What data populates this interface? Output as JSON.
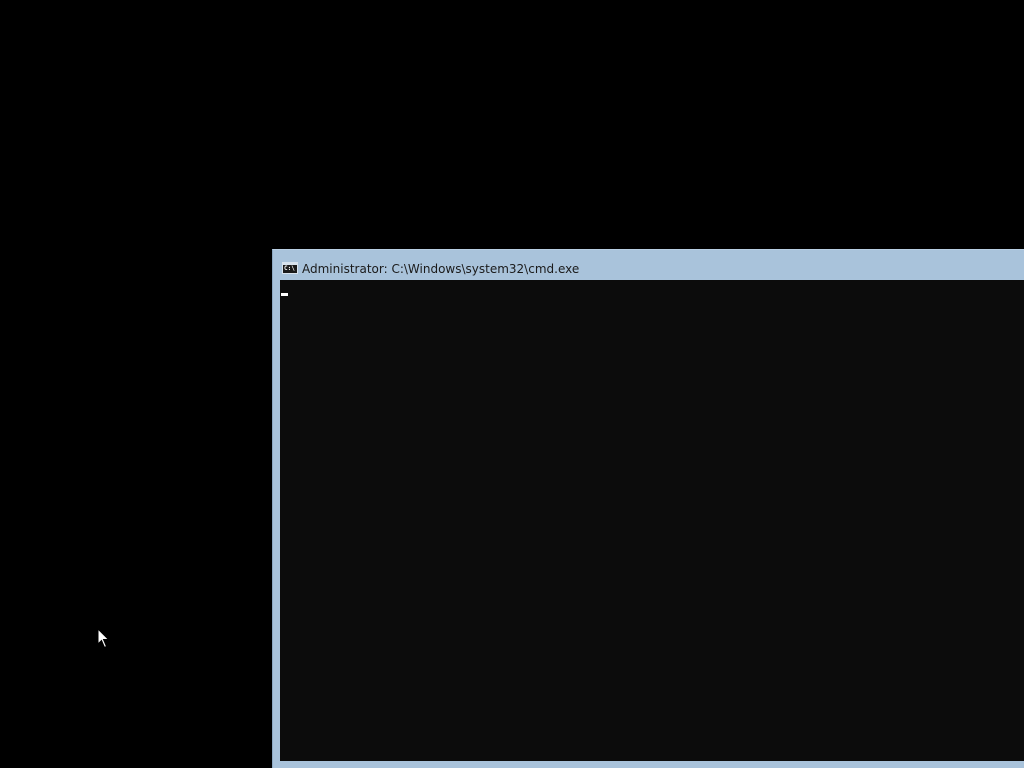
{
  "desktop": {
    "background_color": "#000000",
    "mouse_pointer_icon": "arrow-cursor-icon"
  },
  "window": {
    "title": "Administrator: C:\\Windows\\system32\\cmd.exe",
    "icon": "console-icon",
    "icon_text": "C:\\",
    "frame_color": "#a9c3db",
    "console_background": "#0c0c0c",
    "console_text": "",
    "text_cursor": "blinking-underscore"
  }
}
